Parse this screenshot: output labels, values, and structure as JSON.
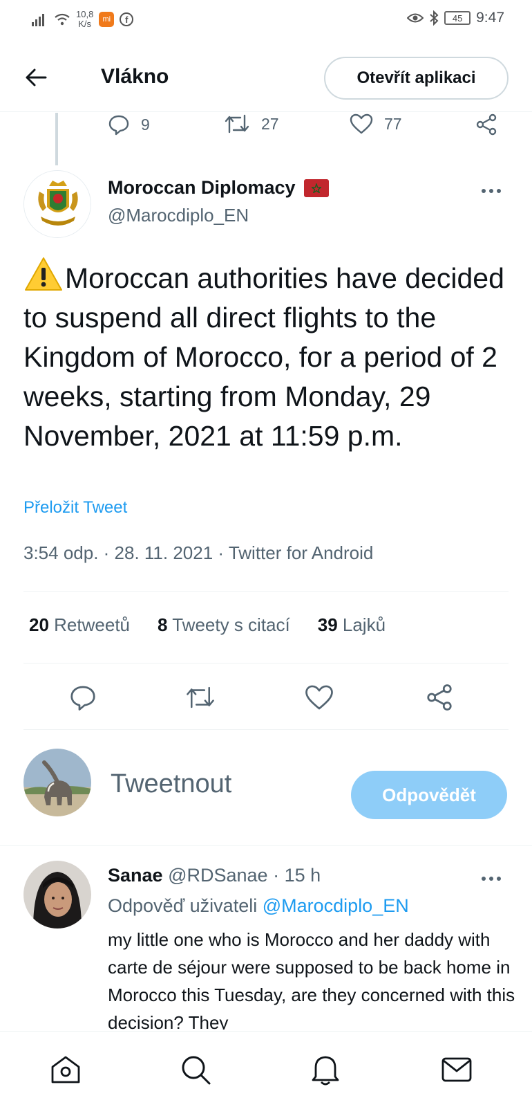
{
  "status_bar": {
    "speed_value": "10,8",
    "speed_unit": "K/s",
    "app_badge": "mi",
    "battery": "45",
    "time": "9:47"
  },
  "header": {
    "title": "Vlákno",
    "open_app_label": "Otevřít aplikaci"
  },
  "previous_tweet": {
    "replies": "9",
    "retweets": "27",
    "likes": "77"
  },
  "tweet": {
    "author_name": "Moroccan Diplomacy",
    "author_handle": "@Marocdiplo_EN",
    "text": "Moroccan authorities have decided to suspend all direct flights to the Kingdom of Morocco, for a period of 2 weeks, starting from Monday, 29 November, 2021 at 11:59 p.m.",
    "translate_label": "Přeložit Tweet",
    "meta": "3:54 odp. · 28. 11. 2021 · Twitter for Android",
    "stats": {
      "retweets_count": "20",
      "retweets_label": "Retweetů",
      "quotes_count": "8",
      "quotes_label": "Tweety s citací",
      "likes_count": "39",
      "likes_label": "Lajků"
    }
  },
  "composer": {
    "placeholder": "Tweetnout",
    "reply_button": "Odpovědět"
  },
  "reply": {
    "name": "Sanae",
    "handle": "@RDSanae",
    "time": "· 15 h",
    "reply_to_prefix": "Odpověď uživateli",
    "reply_to_handle": "@Marocdiplo_EN",
    "text": "my little one who is Morocco and her daddy with carte de séjour were supposed to be back home in Morocco this Tuesday, are they concerned with this decision? They"
  },
  "colors": {
    "accent": "#1d9bf0",
    "muted": "#536471",
    "reply_button_disabled": "#8ecdf8"
  },
  "icons": {
    "back": "arrow-left-icon",
    "reply": "comment-icon",
    "retweet": "retweet-icon",
    "like": "heart-icon",
    "share": "share-icon",
    "more": "more-horizontal-icon",
    "home": "home-icon",
    "search": "search-icon",
    "notifications": "bell-icon",
    "messages": "mail-icon",
    "warning": "warning-icon"
  }
}
